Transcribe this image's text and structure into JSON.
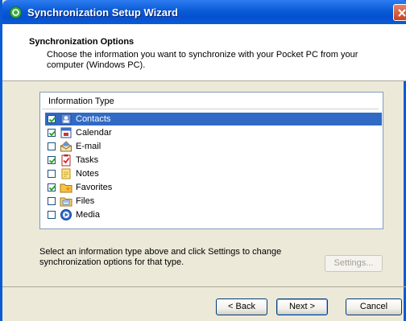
{
  "window": {
    "title": "Synchronization Setup Wizard"
  },
  "header": {
    "title": "Synchronization Options",
    "description": "Choose the information you want to synchronize with your Pocket PC from your computer (Windows PC)."
  },
  "list": {
    "column_header": "Information Type",
    "items": [
      {
        "label": "Contacts",
        "checked": true,
        "selected": true,
        "icon": "contacts-icon"
      },
      {
        "label": "Calendar",
        "checked": true,
        "selected": false,
        "icon": "calendar-icon"
      },
      {
        "label": "E-mail",
        "checked": false,
        "selected": false,
        "icon": "email-icon"
      },
      {
        "label": "Tasks",
        "checked": true,
        "selected": false,
        "icon": "tasks-icon"
      },
      {
        "label": "Notes",
        "checked": false,
        "selected": false,
        "icon": "notes-icon"
      },
      {
        "label": "Favorites",
        "checked": true,
        "selected": false,
        "icon": "favorites-icon"
      },
      {
        "label": "Files",
        "checked": false,
        "selected": false,
        "icon": "files-icon"
      },
      {
        "label": "Media",
        "checked": false,
        "selected": false,
        "icon": "media-icon"
      }
    ]
  },
  "info": "Select an information type above and click Settings to change synchronization options for that type.",
  "buttons": {
    "settings": "Settings...",
    "back": "< Back",
    "next": "Next >",
    "cancel": "Cancel"
  }
}
